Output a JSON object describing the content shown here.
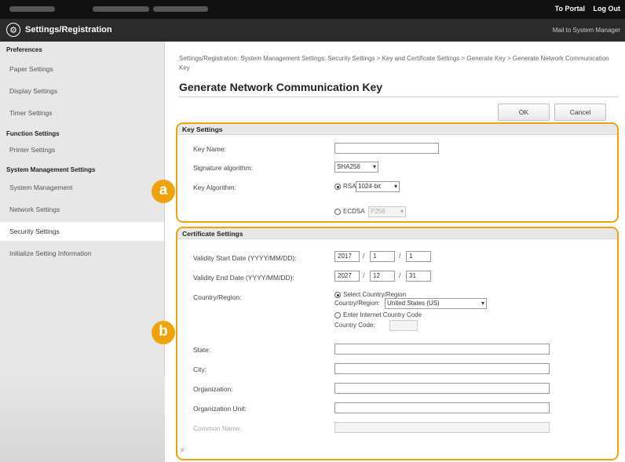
{
  "topbar": {
    "portal_link": "To Portal",
    "logout_link": "Log Out"
  },
  "header": {
    "title": "Settings/Registration",
    "mail_link": "Mail to System Manager"
  },
  "sidebar": {
    "headings": [
      "Preferences",
      "Function Settings",
      "System Management Settings"
    ],
    "items": [
      {
        "label": "Paper Settings"
      },
      {
        "label": "Display Settings"
      },
      {
        "label": "Timer Settings"
      },
      {
        "label": "Printer Settings"
      },
      {
        "label": "System Management"
      },
      {
        "label": "Network Settings"
      },
      {
        "label": "Security Settings",
        "active": true
      },
      {
        "label": "Initialize Setting Information"
      }
    ]
  },
  "breadcrumb": "Settings/Registration: System Management Settings: Security Settings > Key and Certificate Settings > Generate Key > Generate Network Communication Key",
  "page_title": "Generate Network Communication Key",
  "buttons": {
    "ok": "OK",
    "cancel": "Cancel"
  },
  "markers": {
    "a": "a",
    "b": "b"
  },
  "key_settings": {
    "heading": "Key Settings",
    "key_name_label": "Key Name:",
    "key_name_value": "",
    "signature_label": "Signature algorithm:",
    "signature_value": "SHA256",
    "key_algorithm_label": "Key Algorithm:",
    "rsa_label": "RSA",
    "rsa_bits": "1024-bit",
    "ecdsa_label": "ECDSA",
    "ecdsa_curve": "P256"
  },
  "certificate_settings": {
    "heading": "Certificate Settings",
    "start_label": "Validity Start Date (YYYY/MM/DD):",
    "start_year": "2017",
    "start_month": "1",
    "start_day": "1",
    "end_label": "Validity End Date (YYYY/MM/DD):",
    "end_year": "2027",
    "end_month": "12",
    "end_day": "31",
    "country_label": "Country/Region:",
    "select_country_option": "Select Country/Region",
    "country_region_sublabel": "Country/Region:",
    "country_value": "United States (US)",
    "enter_code_option": "Enter Internet Country Code",
    "country_code_sublabel": "Country Code:",
    "country_code_value": "",
    "state_label": "State:",
    "city_label": "City:",
    "organization_label": "Organization:",
    "org_unit_label": "Organization Unit:",
    "common_name_label": "Common Name:"
  },
  "back_to_top_icon": "up-arrow-icon"
}
